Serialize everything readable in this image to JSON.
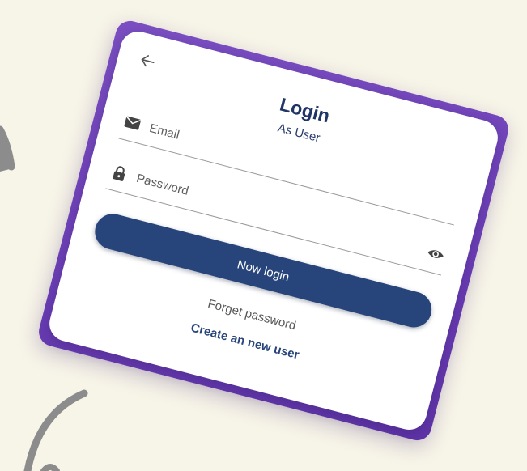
{
  "login": {
    "title": "Login",
    "subtitle": "As User",
    "email_placeholder": "Email",
    "password_placeholder": "Password",
    "submit_label": "Now login",
    "forget_label": "Forget password",
    "create_label": "Create an new user"
  },
  "icons": {
    "back": "arrow-left-icon",
    "email": "envelope-icon",
    "password": "lock-icon",
    "visibility": "eye-icon"
  },
  "colors": {
    "background": "#f7f4e8",
    "frame": "#6a3db4",
    "primary": "#27457a",
    "title": "#1f3566",
    "decoration": "#8c8c8c"
  }
}
